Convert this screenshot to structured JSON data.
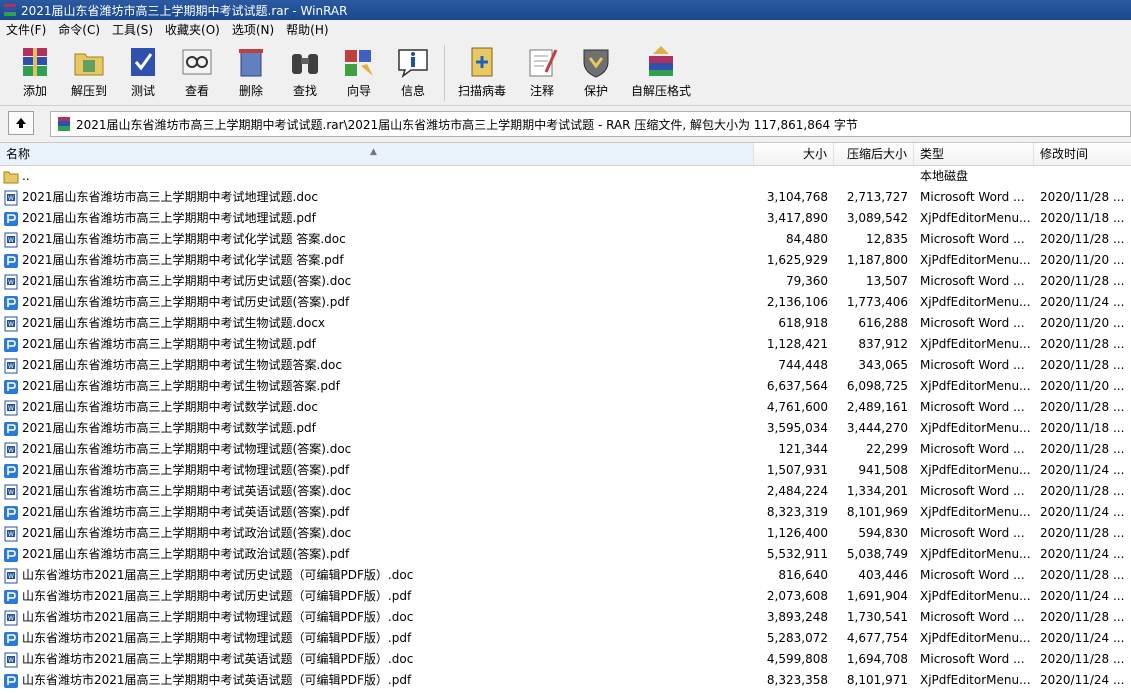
{
  "window": {
    "title": "2021届山东省潍坊市高三上学期期中考试试题.rar - WinRAR"
  },
  "menu": [
    "文件(F)",
    "命令(C)",
    "工具(S)",
    "收藏夹(O)",
    "选项(N)",
    "帮助(H)"
  ],
  "toolbar": {
    "add": "添加",
    "extract": "解压到",
    "test": "测试",
    "view": "查看",
    "delete": "删除",
    "find": "查找",
    "wizard": "向导",
    "info": "信息",
    "virus": "扫描病毒",
    "comment": "注释",
    "protect": "保护",
    "sfx": "自解压格式"
  },
  "address": {
    "path": "2021届山东省潍坊市高三上学期期中考试试题.rar\\2021届山东省潍坊市高三上学期期中考试试题 - RAR 压缩文件, 解包大小为 117,861,864 字节"
  },
  "columns": {
    "name": "名称",
    "size": "大小",
    "packed": "压缩后大小",
    "type": "类型",
    "modified": "修改时间"
  },
  "files": [
    {
      "name": "..",
      "size": "",
      "packed": "",
      "type": "本地磁盘",
      "modified": "",
      "kind": "folder"
    },
    {
      "name": "2021届山东省潍坊市高三上学期期中考试地理试题.doc",
      "size": "3,104,768",
      "packed": "2,713,727",
      "type": "Microsoft Word ...",
      "modified": "2020/11/28 ...",
      "kind": "doc"
    },
    {
      "name": "2021届山东省潍坊市高三上学期期中考试地理试题.pdf",
      "size": "3,417,890",
      "packed": "3,089,542",
      "type": "XjPdfEditorMenu...",
      "modified": "2020/11/18 ...",
      "kind": "pdf"
    },
    {
      "name": "2021届山东省潍坊市高三上学期期中考试化学试题 答案.doc",
      "size": "84,480",
      "packed": "12,835",
      "type": "Microsoft Word ...",
      "modified": "2020/11/28 ...",
      "kind": "doc"
    },
    {
      "name": "2021届山东省潍坊市高三上学期期中考试化学试题 答案.pdf",
      "size": "1,625,929",
      "packed": "1,187,800",
      "type": "XjPdfEditorMenu...",
      "modified": "2020/11/20 ...",
      "kind": "pdf"
    },
    {
      "name": "2021届山东省潍坊市高三上学期期中考试历史试题(答案).doc",
      "size": "79,360",
      "packed": "13,507",
      "type": "Microsoft Word ...",
      "modified": "2020/11/28 ...",
      "kind": "doc"
    },
    {
      "name": "2021届山东省潍坊市高三上学期期中考试历史试题(答案).pdf",
      "size": "2,136,106",
      "packed": "1,773,406",
      "type": "XjPdfEditorMenu...",
      "modified": "2020/11/24 ...",
      "kind": "pdf"
    },
    {
      "name": "2021届山东省潍坊市高三上学期期中考试生物试题.docx",
      "size": "618,918",
      "packed": "616,288",
      "type": "Microsoft Word ...",
      "modified": "2020/11/20 ...",
      "kind": "doc"
    },
    {
      "name": "2021届山东省潍坊市高三上学期期中考试生物试题.pdf",
      "size": "1,128,421",
      "packed": "837,912",
      "type": "XjPdfEditorMenu...",
      "modified": "2020/11/28 ...",
      "kind": "pdf"
    },
    {
      "name": "2021届山东省潍坊市高三上学期期中考试生物试题答案.doc",
      "size": "744,448",
      "packed": "343,065",
      "type": "Microsoft Word ...",
      "modified": "2020/11/28 ...",
      "kind": "doc"
    },
    {
      "name": "2021届山东省潍坊市高三上学期期中考试生物试题答案.pdf",
      "size": "6,637,564",
      "packed": "6,098,725",
      "type": "XjPdfEditorMenu...",
      "modified": "2020/11/20 ...",
      "kind": "pdf"
    },
    {
      "name": "2021届山东省潍坊市高三上学期期中考试数学试题.doc",
      "size": "4,761,600",
      "packed": "2,489,161",
      "type": "Microsoft Word ...",
      "modified": "2020/11/28 ...",
      "kind": "doc"
    },
    {
      "name": "2021届山东省潍坊市高三上学期期中考试数学试题.pdf",
      "size": "3,595,034",
      "packed": "3,444,270",
      "type": "XjPdfEditorMenu...",
      "modified": "2020/11/18 ...",
      "kind": "pdf"
    },
    {
      "name": "2021届山东省潍坊市高三上学期期中考试物理试题(答案).doc",
      "size": "121,344",
      "packed": "22,299",
      "type": "Microsoft Word ...",
      "modified": "2020/11/28 ...",
      "kind": "doc"
    },
    {
      "name": "2021届山东省潍坊市高三上学期期中考试物理试题(答案).pdf",
      "size": "1,507,931",
      "packed": "941,508",
      "type": "XjPdfEditorMenu...",
      "modified": "2020/11/24 ...",
      "kind": "pdf"
    },
    {
      "name": "2021届山东省潍坊市高三上学期期中考试英语试题(答案).doc",
      "size": "2,484,224",
      "packed": "1,334,201",
      "type": "Microsoft Word ...",
      "modified": "2020/11/28 ...",
      "kind": "doc"
    },
    {
      "name": "2021届山东省潍坊市高三上学期期中考试英语试题(答案).pdf",
      "size": "8,323,319",
      "packed": "8,101,969",
      "type": "XjPdfEditorMenu...",
      "modified": "2020/11/24 ...",
      "kind": "pdf"
    },
    {
      "name": "2021届山东省潍坊市高三上学期期中考试政治试题(答案).doc",
      "size": "1,126,400",
      "packed": "594,830",
      "type": "Microsoft Word ...",
      "modified": "2020/11/28 ...",
      "kind": "doc"
    },
    {
      "name": "2021届山东省潍坊市高三上学期期中考试政治试题(答案).pdf",
      "size": "5,532,911",
      "packed": "5,038,749",
      "type": "XjPdfEditorMenu...",
      "modified": "2020/11/24 ...",
      "kind": "pdf"
    },
    {
      "name": "山东省潍坊市2021届高三上学期期中考试历史试题（可编辑PDF版）.doc",
      "size": "816,640",
      "packed": "403,446",
      "type": "Microsoft Word ...",
      "modified": "2020/11/28 ...",
      "kind": "doc"
    },
    {
      "name": "山东省潍坊市2021届高三上学期期中考试历史试题（可编辑PDF版）.pdf",
      "size": "2,073,608",
      "packed": "1,691,904",
      "type": "XjPdfEditorMenu...",
      "modified": "2020/11/24 ...",
      "kind": "pdf"
    },
    {
      "name": "山东省潍坊市2021届高三上学期期中考试物理试题（可编辑PDF版）.doc",
      "size": "3,893,248",
      "packed": "1,730,541",
      "type": "Microsoft Word ...",
      "modified": "2020/11/28 ...",
      "kind": "doc"
    },
    {
      "name": "山东省潍坊市2021届高三上学期期中考试物理试题（可编辑PDF版）.pdf",
      "size": "5,283,072",
      "packed": "4,677,754",
      "type": "XjPdfEditorMenu...",
      "modified": "2020/11/24 ...",
      "kind": "pdf"
    },
    {
      "name": "山东省潍坊市2021届高三上学期期中考试英语试题（可编辑PDF版）.doc",
      "size": "4,599,808",
      "packed": "1,694,708",
      "type": "Microsoft Word ...",
      "modified": "2020/11/28 ...",
      "kind": "doc"
    },
    {
      "name": "山东省潍坊市2021届高三上学期期中考试英语试题（可编辑PDF版）.pdf",
      "size": "8,323,358",
      "packed": "8,101,971",
      "type": "XjPdfEditorMenu...",
      "modified": "2020/11/24 ...",
      "kind": "pdf"
    }
  ]
}
